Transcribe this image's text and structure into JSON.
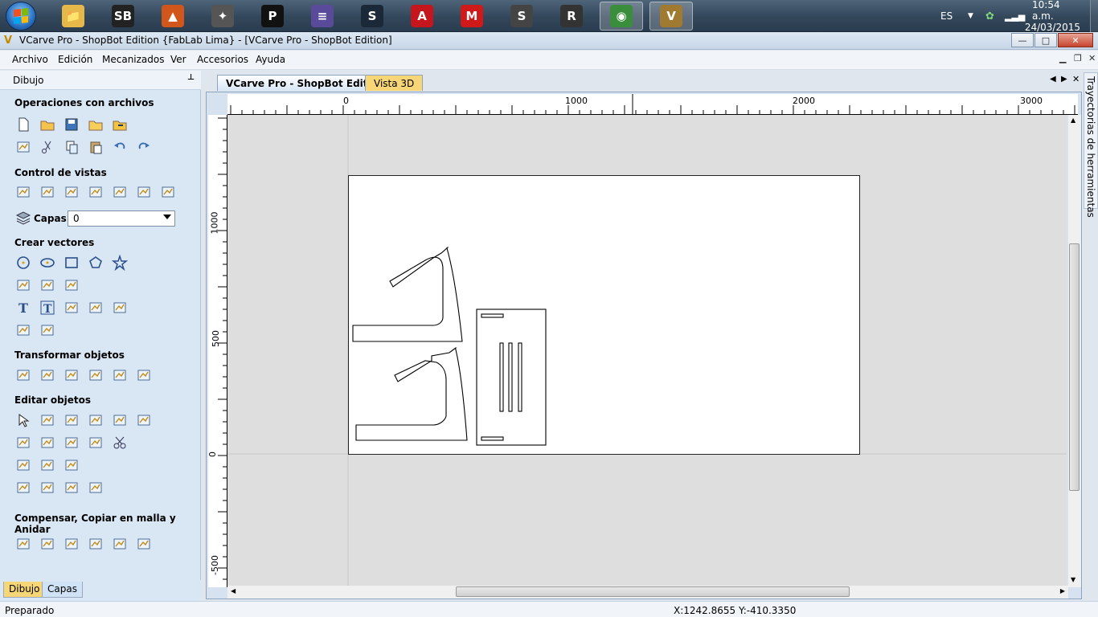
{
  "taskbar": {
    "apps": [
      {
        "name": "windows-explorer",
        "glyph": "📁",
        "color": "#e6b84a"
      },
      {
        "name": "shopbot",
        "glyph": "SB",
        "color": "#222"
      },
      {
        "name": "matlab",
        "glyph": "▲",
        "color": "#d0561b"
      },
      {
        "name": "inkscape",
        "glyph": "✦",
        "color": "#555"
      },
      {
        "name": "processing",
        "glyph": "P",
        "color": "#111"
      },
      {
        "name": "equalizer",
        "glyph": "≡",
        "color": "#5a4a9a"
      },
      {
        "name": "steam",
        "glyph": "S",
        "color": "#1b2838"
      },
      {
        "name": "autocad",
        "glyph": "A",
        "color": "#c4161c"
      },
      {
        "name": "mplab",
        "glyph": "M",
        "color": "#d01a1a"
      },
      {
        "name": "sublime",
        "glyph": "S",
        "color": "#444"
      },
      {
        "name": "rhino",
        "glyph": "R",
        "color": "#333"
      },
      {
        "name": "chrome",
        "glyph": "◉",
        "color": "#3a8d3a"
      },
      {
        "name": "vcarve",
        "glyph": "V",
        "color": "#a07a30"
      }
    ],
    "language": "ES",
    "time": "10:54 a.m.",
    "date": "24/03/2015"
  },
  "window": {
    "title": "VCarve Pro - ShopBot Edition {FabLab Lima} - [VCarve Pro - ShopBot Edition]",
    "minimize": "—",
    "maximize": "□",
    "close": "✕"
  },
  "menu": [
    "Archivo",
    "Edición",
    "Mecanizados",
    "Ver",
    "Accesorios",
    "Ayuda"
  ],
  "leftpanel": {
    "title": "Dibujo",
    "pin": "📌",
    "sections": {
      "file_ops": "Operaciones con archivos",
      "view_ctrl": "Control de vistas",
      "layers_label": "Capas",
      "layers_value": "0",
      "create_vectors": "Crear vectores",
      "transform": "Transformar objetos",
      "edit": "Editar objetos",
      "offset": "Compensar, Copiar en malla y Anidar"
    },
    "bottom_tabs": [
      "Dibujo",
      "Capas"
    ]
  },
  "doctabs": [
    "VCarve Pro - ShopBot Edition",
    "Vista 3D"
  ],
  "ruler": {
    "h_labels": [
      "0",
      "1000",
      "2000",
      "3000"
    ],
    "v_labels": [
      "1000",
      "500",
      "0",
      "-500"
    ]
  },
  "right_panel": "Trayectorias de herramientas",
  "status": {
    "left": "Preparado",
    "coords": "X:1242.8655 Y:-410.3350"
  }
}
